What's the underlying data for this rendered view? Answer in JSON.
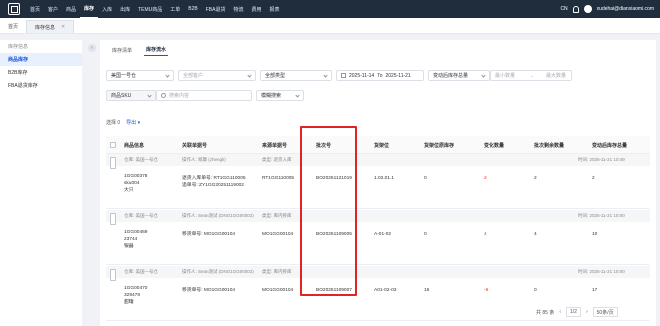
{
  "topbar": {
    "nav": [
      "首页",
      "客户",
      "商品",
      "库存",
      "入库",
      "出库",
      "TEMU商品",
      "工单",
      "B2B",
      "FBA退货",
      "物流",
      "费用",
      "报表"
    ],
    "active_nav": "库存",
    "lang": "CN",
    "user": "xudehai@dianxiaomi.com"
  },
  "page_tabs": [
    {
      "label": "首页",
      "active": false
    },
    {
      "label": "库存信息",
      "active": true
    }
  ],
  "sidebar": {
    "items": [
      {
        "label": "库存信息",
        "group": true
      },
      {
        "label": "商品库存",
        "active": true
      },
      {
        "label": "B2B库存"
      },
      {
        "label": "FBA退货库存"
      }
    ]
  },
  "sub_tabs": [
    {
      "label": "库存清单",
      "active": false
    },
    {
      "label": "库存流水",
      "active": true
    }
  ],
  "filters": {
    "warehouse": "美国一号仓",
    "customer_placeholder": "全部客户",
    "type": "全部类型",
    "date_from": "2025-11-14",
    "date_to_label": "To",
    "date_to": "2025-11-21",
    "qty_type": "变动后库存总量",
    "min_placeholder": "最小数量",
    "max_placeholder": "最大数量",
    "sku_type": "商品SKU",
    "search_placeholder": "搜索内容",
    "match_mode": "模糊搜索"
  },
  "selection": {
    "selected_label": "选择 0",
    "export_label": "导出"
  },
  "table": {
    "headers": [
      "商品信息",
      "关联单据号",
      "来源单据号",
      "批次号",
      "货架位",
      "货架位原库存",
      "变化数量",
      "批次剩余数量",
      "变动后库存总量"
    ],
    "groups": [
      {
        "meta": {
          "warehouse": "仓库: 美国一号仓",
          "operator": "操作人: 郑康 (zhengk)",
          "type": "类型: 退货入库",
          "time": "时间: 2025-11-21 10:49"
        },
        "product": [
          "1GG00378",
          "sku004",
          "大只"
        ],
        "related": [
          "退货入库单号: RT1GG110005",
          "追单号: ZY1GG20251119002"
        ],
        "source": "RT1GG110005",
        "batch": "BO20251121019",
        "shelf": "1.02.01.1",
        "orig_qty": "0",
        "change": "2",
        "change_color": "red",
        "batch_remaining": "2",
        "total_after": "2"
      },
      {
        "meta": {
          "warehouse": "仓库: 美国一号仓",
          "operator": "操作人: Sean测试 (DNO1GG00002)",
          "type": "类型: 库内移库",
          "time": "时间: 2025-11-21 10:00"
        },
        "product": [
          "1GG00469",
          "23744",
          "银器"
        ],
        "related": [
          "移货单号: MO1GG00104"
        ],
        "source": "MO1GG00104",
        "batch": "BO20251109005",
        "shelf": "A-01-02",
        "orig_qty": "0",
        "change": "4",
        "change_color": "green",
        "batch_remaining": "4",
        "total_after": "10"
      },
      {
        "meta": {
          "warehouse": "仓库: 美国一号仓",
          "operator": "操作人: Sean测试 (DNO1GG00002)",
          "type": "类型: 库内移库",
          "time": "时间: 2025-11-21 10:00"
        },
        "product": [
          "1GG00470",
          "329478",
          "甜罐"
        ],
        "related": [
          "移货单号: MO1GG00104"
        ],
        "source": "MO1GG00104",
        "batch": "BO20251109007",
        "shelf": "A01-02-03",
        "orig_qty": "16",
        "change": "-6",
        "change_color": "red",
        "batch_remaining": "0",
        "total_after": "17"
      }
    ]
  },
  "pagination": {
    "total": "共 85 条",
    "page": "1/2",
    "page_size": "50条/页"
  }
}
